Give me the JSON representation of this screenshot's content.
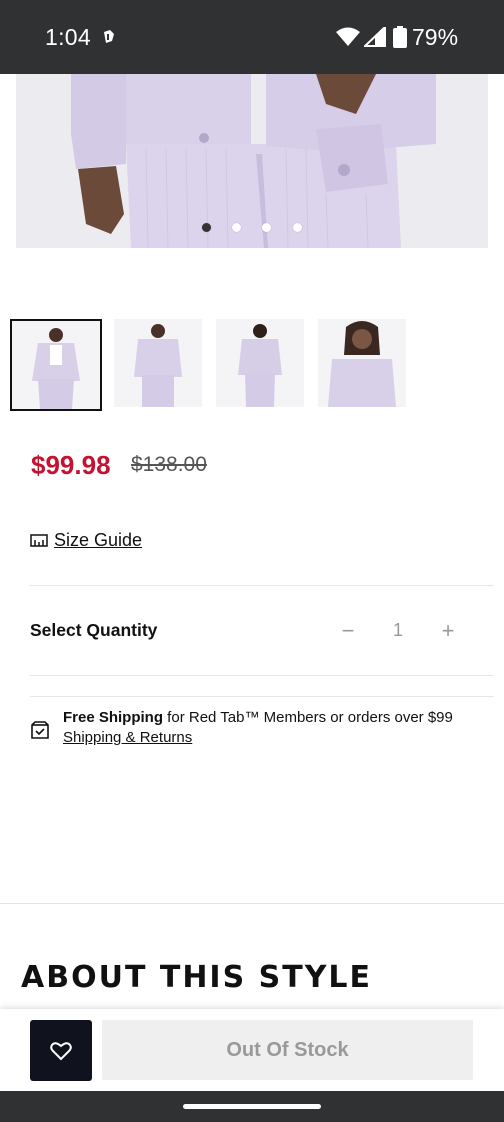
{
  "status_bar": {
    "time": "1:04",
    "battery": "79%",
    "icons": [
      "vpn-key-icon",
      "wifi-icon",
      "signal-icon",
      "battery-icon"
    ]
  },
  "product": {
    "image_count": 4,
    "active_image_index": 0,
    "thumbnail_count": 4,
    "selected_thumbnail_index": 0,
    "sale_price": "$99.98",
    "original_price": "$138.00",
    "colors": {
      "sale": "#c41230",
      "garment": "#d8d0e8"
    }
  },
  "size_guide": {
    "label": "Size Guide",
    "icon": "ruler-icon"
  },
  "quantity": {
    "label": "Select Quantity",
    "value": "1",
    "minus": "−",
    "plus": "+"
  },
  "shipping": {
    "bold": "Free Shipping",
    "text": " for Red Tab™ Members or orders over $99",
    "link": "Shipping & Returns",
    "icon": "shipping-box-icon"
  },
  "about": {
    "heading": "ABOUT THIS STYLE"
  },
  "action_bar": {
    "wishlist_icon": "heart-icon",
    "button_label": "Out Of Stock",
    "colors": {
      "wishlist_bg": "#10131e",
      "button_bg": "#efefef"
    }
  }
}
